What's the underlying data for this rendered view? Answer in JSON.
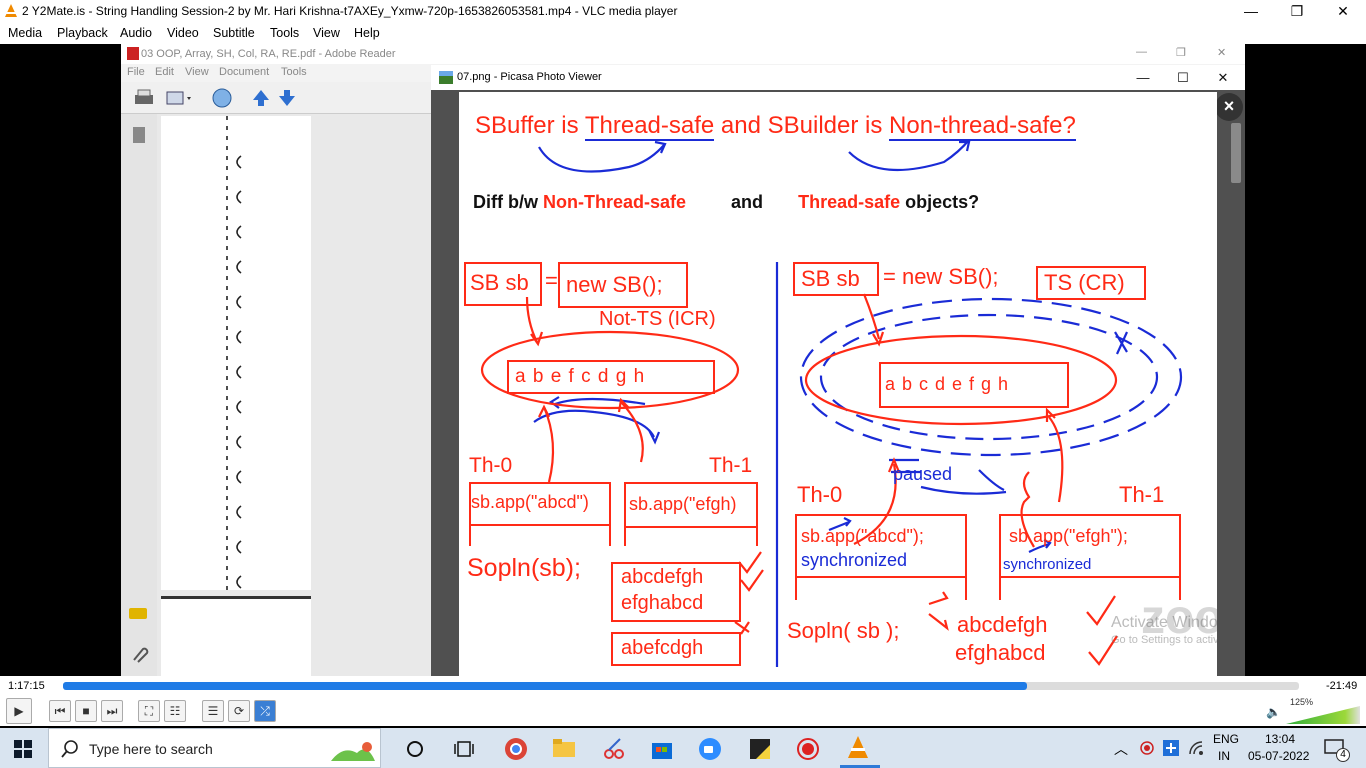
{
  "vlc": {
    "title": "2 Y2Mate.is - String Handling Session-2  by Mr. Hari Krishna-t7AXEy_Yxmw-720p-1653826053581.mp4 - VLC media player",
    "menu": [
      "Media",
      "Playback",
      "Audio",
      "Video",
      "Subtitle",
      "Tools",
      "View",
      "Help"
    ],
    "time_elapsed": "1:17:15",
    "time_remaining": "-21:49",
    "progress_fraction": 0.78,
    "volume_label": "125%",
    "controls": [
      "play-icon",
      "prev-icon",
      "stop-icon",
      "next-icon",
      "fullscreen-icon",
      "extended-settings-icon",
      "playlist-icon",
      "loop-icon",
      "shuffle-icon"
    ]
  },
  "reader": {
    "title": "03 OOP, Array, SH, Col, RA, RE.pdf - Adobe Reader",
    "menu": [
      "File",
      "Edit",
      "View",
      "Document",
      "Tools"
    ]
  },
  "picasa": {
    "title": "07.png - Picasa Photo Viewer",
    "close_x": "×"
  },
  "slide": {
    "heading_1": "SBuffer is",
    "heading_2": "Thread-safe",
    "heading_3": "and SBuilder is",
    "heading_4": "Non-thread-safe?",
    "diff_1": "Diff b/w",
    "diff_2": "Non-Thread-safe",
    "diff_3": "and",
    "diff_4": "Thread-safe",
    "diff_5": "objects?",
    "left": {
      "sb_box": "SB sb",
      "eq": "=",
      "new_box": "new SB();",
      "note": "Not-TS (ICR)",
      "buffer": "a b e f c d g h",
      "th0": "Th-0",
      "th1": "Th-1",
      "app0": "sb.app(\"abcd\")",
      "app1": "sb.app(\"efgh)",
      "sopln": "Sopln(sb);",
      "out1": "abcdefgh",
      "out2": "efghabcd",
      "out3": "abefcdgh"
    },
    "right": {
      "sb_box": "SB sb",
      "rest": "= new SB();",
      "ts_box": "TS (CR)",
      "buffer": "a  b c d e f g h",
      "paused": "paused",
      "th0": "Th-0",
      "th1": "Th-1",
      "app0": "sb.app(\"abcd\");",
      "sync0": "synchronized",
      "app1": "sb.app(\"efgh\");",
      "sync1": "synchronized",
      "sopln": "Sopln( sb );",
      "out1": "abcdefgh",
      "out2": "efghabcd",
      "watermark": "zoom",
      "activate": "Activate Windows",
      "activate_sub": "Go to Settings to activate Windows."
    }
  },
  "taskbar": {
    "search_placeholder": "Type here to search",
    "lang": "ENG",
    "region": "IN",
    "time": "13:04",
    "date": "05-07-2022",
    "notifications": "4"
  },
  "colors": {
    "red": "#ff2a16",
    "blue": "#1a2bd6",
    "seek": "#1f7be6"
  }
}
